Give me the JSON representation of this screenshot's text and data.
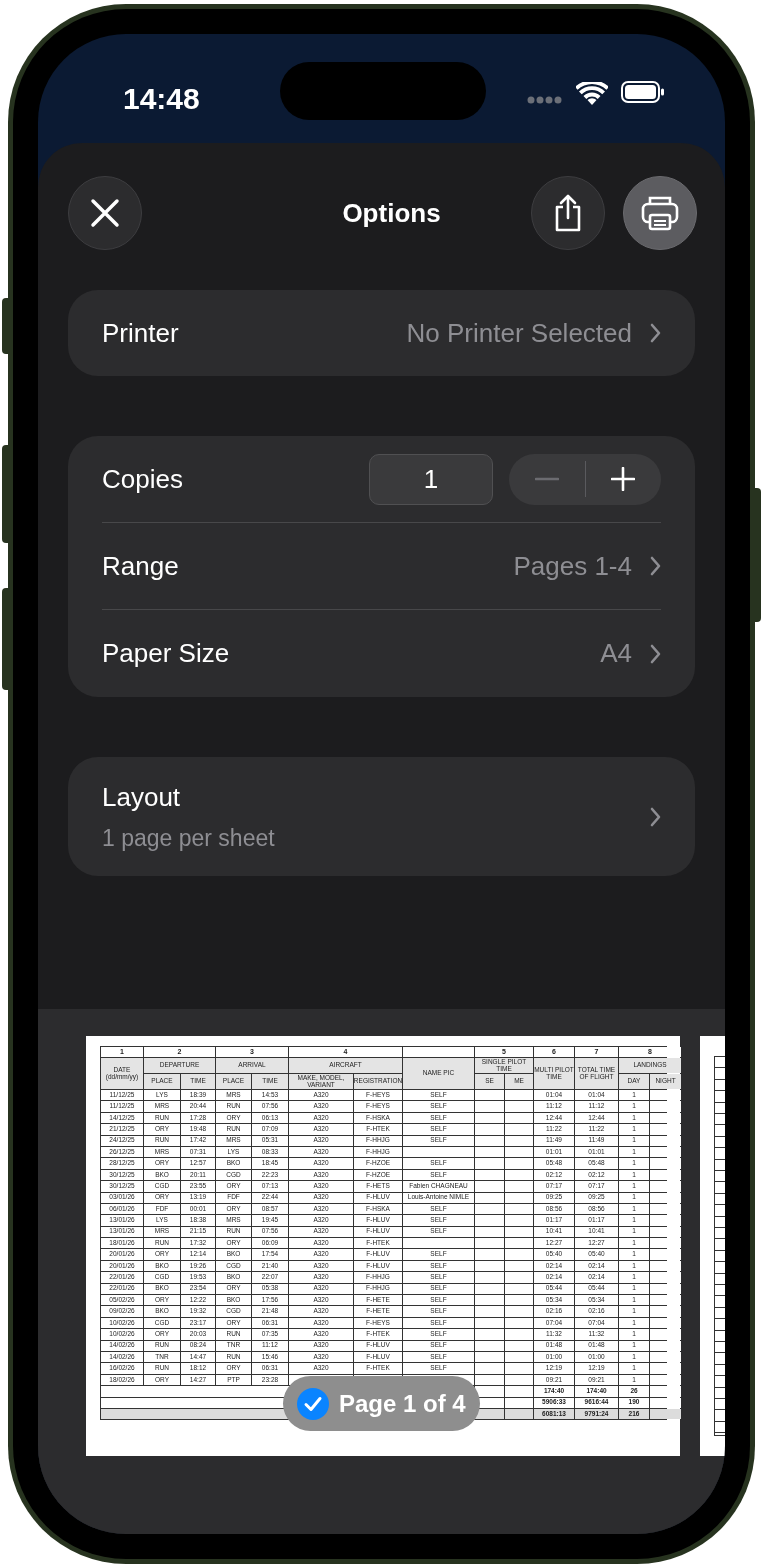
{
  "status_bar": {
    "time": "14:48"
  },
  "header": {
    "title": "Options"
  },
  "printer": {
    "label": "Printer",
    "value": "No Printer Selected"
  },
  "settings": [
    {
      "kind": "stepper",
      "label": "Copies",
      "value": "1",
      "minus_disabled": true
    },
    {
      "kind": "link",
      "label": "Range",
      "value": "Pages 1-4"
    },
    {
      "kind": "link",
      "label": "Paper Size",
      "value": "A4"
    }
  ],
  "layout": {
    "label": "Layout",
    "value": "1 page per sheet"
  },
  "preview": {
    "page_badge": "Page 1 of 4",
    "selected": true,
    "document": {
      "groups": [
        {
          "number": "1",
          "title": "DATE\n(dd/mm/yy)"
        },
        {
          "number": "2",
          "title": "DEPARTURE",
          "subs": [
            "PLACE",
            "TIME"
          ]
        },
        {
          "number": "3",
          "title": "ARRIVAL",
          "subs": [
            "PLACE",
            "TIME"
          ]
        },
        {
          "number": "4",
          "title": "AIRCRAFT",
          "subs": [
            "MAKE, MODEL, VARIANT",
            "REGISTRATION"
          ]
        },
        {
          "title": "NAME PIC"
        },
        {
          "number": "5",
          "title": "SINGLE PILOT TIME",
          "subs": [
            "SE",
            "ME"
          ]
        },
        {
          "number": "6",
          "title": "MULTI PILOT TIME"
        },
        {
          "number": "7",
          "title": "TOTAL TIME OF FLIGHT"
        },
        {
          "number": "8",
          "title": "LANDINGS",
          "subs": [
            "DAY",
            "NIGHT"
          ]
        }
      ],
      "rows": [
        {
          "date": "11/12/25",
          "dep_place": "LYS",
          "dep_time": "18:39",
          "arr_place": "MRS",
          "arr_time": "14:53",
          "type": "A320",
          "reg": "F-HEYS",
          "pic": "SELF",
          "multi": "01:04",
          "total": "01:04",
          "day": "1"
        },
        {
          "date": "11/12/25",
          "dep_place": "MRS",
          "dep_time": "20:44",
          "arr_place": "RUN",
          "arr_time": "07:56",
          "type": "A320",
          "reg": "F-HEYS",
          "pic": "SELF",
          "multi": "11:12",
          "total": "11:12",
          "day": "1"
        },
        {
          "date": "14/12/25",
          "dep_place": "RUN",
          "dep_time": "17:28",
          "arr_place": "ORY",
          "arr_time": "06:13",
          "type": "A320",
          "reg": "F-HSKA",
          "pic": "SELF",
          "multi": "12:44",
          "total": "12:44",
          "day": "1"
        },
        {
          "date": "21/12/25",
          "dep_place": "ORY",
          "dep_time": "19:48",
          "arr_place": "RUN",
          "arr_time": "07:09",
          "type": "A320",
          "reg": "F-HTEK",
          "pic": "SELF",
          "multi": "11:22",
          "total": "11:22",
          "day": "1"
        },
        {
          "date": "24/12/25",
          "dep_place": "RUN",
          "dep_time": "17:42",
          "arr_place": "MRS",
          "arr_time": "05:31",
          "type": "A320",
          "reg": "F-HHJG",
          "pic": "SELF",
          "multi": "11:49",
          "total": "11:49",
          "day": "1"
        },
        {
          "date": "26/12/25",
          "dep_place": "MRS",
          "dep_time": "07:31",
          "arr_place": "LYS",
          "arr_time": "08:33",
          "type": "A320",
          "reg": "F-HHJG",
          "multi": "01:01",
          "total": "01:01",
          "day": "1"
        },
        {
          "date": "28/12/25",
          "dep_place": "ORY",
          "dep_time": "12:57",
          "arr_place": "BKO",
          "arr_time": "18:45",
          "type": "A320",
          "reg": "F-HZOE",
          "pic": "SELF",
          "multi": "05:48",
          "total": "05:48",
          "day": "1"
        },
        {
          "date": "30/12/25",
          "dep_place": "BKO",
          "dep_time": "20:11",
          "arr_place": "CGD",
          "arr_time": "22:23",
          "type": "A320",
          "reg": "F-HZOE",
          "pic": "SELF",
          "multi": "02:12",
          "total": "02:12",
          "day": "1"
        },
        {
          "date": "30/12/25",
          "dep_place": "CGD",
          "dep_time": "23:55",
          "arr_place": "ORY",
          "arr_time": "07:13",
          "type": "A320",
          "reg": "F-HETS",
          "pic": "Fabien CHAGNEAU",
          "multi": "07:17",
          "total": "07:17",
          "day": "1"
        },
        {
          "date": "03/01/26",
          "dep_place": "ORY",
          "dep_time": "13:19",
          "arr_place": "FDF",
          "arr_time": "22:44",
          "type": "A320",
          "reg": "F-HLUV",
          "pic": "Louis-Antoine NIMLE",
          "multi": "09:25",
          "total": "09:25",
          "day": "1"
        },
        {
          "date": "06/01/26",
          "dep_place": "FDF",
          "dep_time": "00:01",
          "arr_place": "ORY",
          "arr_time": "08:57",
          "type": "A320",
          "reg": "F-HSKA",
          "pic": "SELF",
          "multi": "08:56",
          "total": "08:56",
          "day": "1"
        },
        {
          "date": "13/01/26",
          "dep_place": "LYS",
          "dep_time": "18:38",
          "arr_place": "MRS",
          "arr_time": "19:45",
          "type": "A320",
          "reg": "F-HLUV",
          "pic": "SELF",
          "multi": "01:17",
          "total": "01:17",
          "day": "1"
        },
        {
          "date": "13/01/26",
          "dep_place": "MRS",
          "dep_time": "21:15",
          "arr_place": "RUN",
          "arr_time": "07:56",
          "type": "A320",
          "reg": "F-HLUV",
          "pic": "SELF",
          "multi": "10:41",
          "total": "10:41",
          "day": "1"
        },
        {
          "date": "18/01/26",
          "dep_place": "RUN",
          "dep_time": "17:32",
          "arr_place": "ORY",
          "arr_time": "06:09",
          "type": "A320",
          "reg": "F-HTEK",
          "multi": "12:27",
          "total": "12:27",
          "day": "1"
        },
        {
          "date": "20/01/26",
          "dep_place": "ORY",
          "dep_time": "12:14",
          "arr_place": "BKO",
          "arr_time": "17:54",
          "type": "A320",
          "reg": "F-HLUV",
          "pic": "SELF",
          "multi": "05:40",
          "total": "05:40",
          "day": "1"
        },
        {
          "date": "20/01/26",
          "dep_place": "BKO",
          "dep_time": "19:26",
          "arr_place": "CGD",
          "arr_time": "21:40",
          "type": "A320",
          "reg": "F-HLUV",
          "pic": "SELF",
          "multi": "02:14",
          "total": "02:14",
          "day": "1"
        },
        {
          "date": "22/01/26",
          "dep_place": "CGD",
          "dep_time": "19:53",
          "arr_place": "BKO",
          "arr_time": "22:07",
          "type": "A320",
          "reg": "F-HHJG",
          "pic": "SELF",
          "multi": "02:14",
          "total": "02:14",
          "day": "1"
        },
        {
          "date": "22/01/26",
          "dep_place": "BKO",
          "dep_time": "23:54",
          "arr_place": "ORY",
          "arr_time": "05:38",
          "type": "A320",
          "reg": "F-HHJG",
          "pic": "SELF",
          "multi": "05:44",
          "total": "05:44",
          "day": "1"
        },
        {
          "date": "05/02/26",
          "dep_place": "ORY",
          "dep_time": "12:22",
          "arr_place": "BKO",
          "arr_time": "17:56",
          "type": "A320",
          "reg": "F-HETE",
          "pic": "SELF",
          "multi": "05:34",
          "total": "05:34",
          "day": "1"
        },
        {
          "date": "09/02/26",
          "dep_place": "BKO",
          "dep_time": "19:32",
          "arr_place": "CGD",
          "arr_time": "21:48",
          "type": "A320",
          "reg": "F-HETE",
          "pic": "SELF",
          "multi": "02:16",
          "total": "02:16",
          "day": "1"
        },
        {
          "date": "10/02/26",
          "dep_place": "CGD",
          "dep_time": "23:17",
          "arr_place": "ORY",
          "arr_time": "06:31",
          "type": "A320",
          "reg": "F-HEYS",
          "pic": "SELF",
          "multi": "07:04",
          "total": "07:04",
          "day": "1"
        },
        {
          "date": "10/02/26",
          "dep_place": "ORY",
          "dep_time": "20:03",
          "arr_place": "RUN",
          "arr_time": "07:35",
          "type": "A320",
          "reg": "F-HTEK",
          "pic": "SELF",
          "multi": "11:32",
          "total": "11:32",
          "day": "1"
        },
        {
          "date": "14/02/26",
          "dep_place": "RUN",
          "dep_time": "08:24",
          "arr_place": "TNR",
          "arr_time": "11:12",
          "type": "A320",
          "reg": "F-HLUV",
          "pic": "SELF",
          "multi": "01:48",
          "total": "01:48",
          "day": "1"
        },
        {
          "date": "14/02/26",
          "dep_place": "TNR",
          "dep_time": "14:47",
          "arr_place": "RUN",
          "arr_time": "15:46",
          "type": "A320",
          "reg": "F-HLUV",
          "pic": "SELF",
          "multi": "01:00",
          "total": "01:00",
          "day": "1"
        },
        {
          "date": "16/02/26",
          "dep_place": "RUN",
          "dep_time": "18:12",
          "arr_place": "ORY",
          "arr_time": "06:31",
          "type": "A320",
          "reg": "F-HTEK",
          "pic": "SELF",
          "multi": "12:19",
          "total": "12:19",
          "day": "1"
        },
        {
          "date": "18/02/26",
          "dep_place": "ORY",
          "dep_time": "14:27",
          "arr_place": "PTP",
          "arr_time": "23:28",
          "multi": "09:21",
          "total": "09:21",
          "day": "1"
        }
      ],
      "totals": [
        {
          "multi": "174:40",
          "total": "174:40",
          "day": "26",
          "shaded": false
        },
        {
          "multi": "5906:33",
          "total": "9616:44",
          "day": "190",
          "shaded": false
        },
        {
          "multi": "6081:13",
          "total": "9791:24",
          "day": "216",
          "shaded": true
        }
      ]
    }
  }
}
